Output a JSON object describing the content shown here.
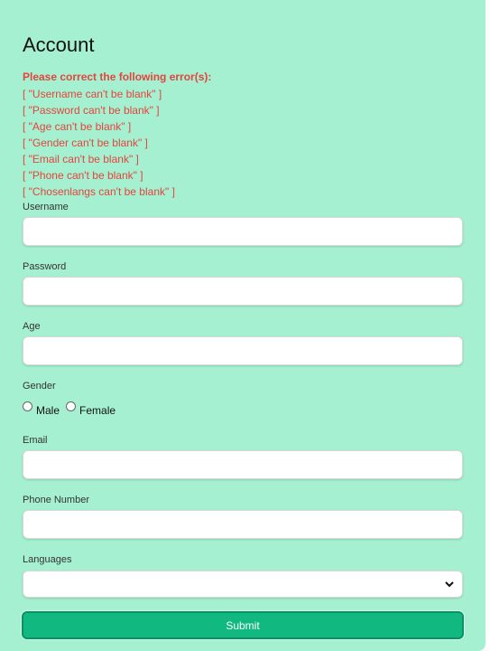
{
  "form": {
    "title": "Account",
    "errors": {
      "heading": "Please correct the following error(s):",
      "items": [
        "[ \"Username can't be blank\" ]",
        "[ \"Password can't be blank\" ]",
        "[ \"Age can't be blank\" ]",
        "[ \"Gender can't be blank\" ]",
        "[ \"Email can't be blank\" ]",
        "[ \"Phone can't be blank\" ]",
        "[ \"Chosenlangs can't be blank\" ]"
      ]
    },
    "fields": {
      "username": {
        "label": "Username",
        "value": ""
      },
      "password": {
        "label": "Password",
        "value": ""
      },
      "age": {
        "label": "Age",
        "value": ""
      },
      "gender": {
        "label": "Gender",
        "options": [
          "Male",
          "Female"
        ]
      },
      "email": {
        "label": "Email",
        "value": ""
      },
      "phone": {
        "label": "Phone Number",
        "value": ""
      },
      "languages": {
        "label": "Languages",
        "selected": ""
      }
    },
    "submit_label": "Submit"
  },
  "colors": {
    "background": "#a5f0d1",
    "error": "#e2453c",
    "submit": "#11b981"
  }
}
